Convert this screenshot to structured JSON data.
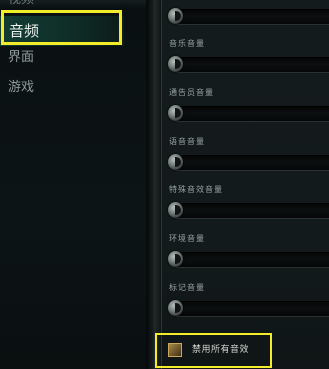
{
  "nav": {
    "cutoff_label": "视频",
    "items": [
      {
        "label": "音频"
      },
      {
        "label": "界面"
      },
      {
        "label": "游戏"
      }
    ]
  },
  "sliders": [
    {
      "label": ""
    },
    {
      "label": "音乐音量"
    },
    {
      "label": "通告员音量"
    },
    {
      "label": "语音音量"
    },
    {
      "label": "特殊音效音量"
    },
    {
      "label": "环境音量"
    },
    {
      "label": "标记音量"
    }
  ],
  "mute_all": {
    "label": "禁用所有音效",
    "checked": true
  },
  "colors": {
    "highlight": "#f2ec2a",
    "selected_nav": "#123c34"
  }
}
